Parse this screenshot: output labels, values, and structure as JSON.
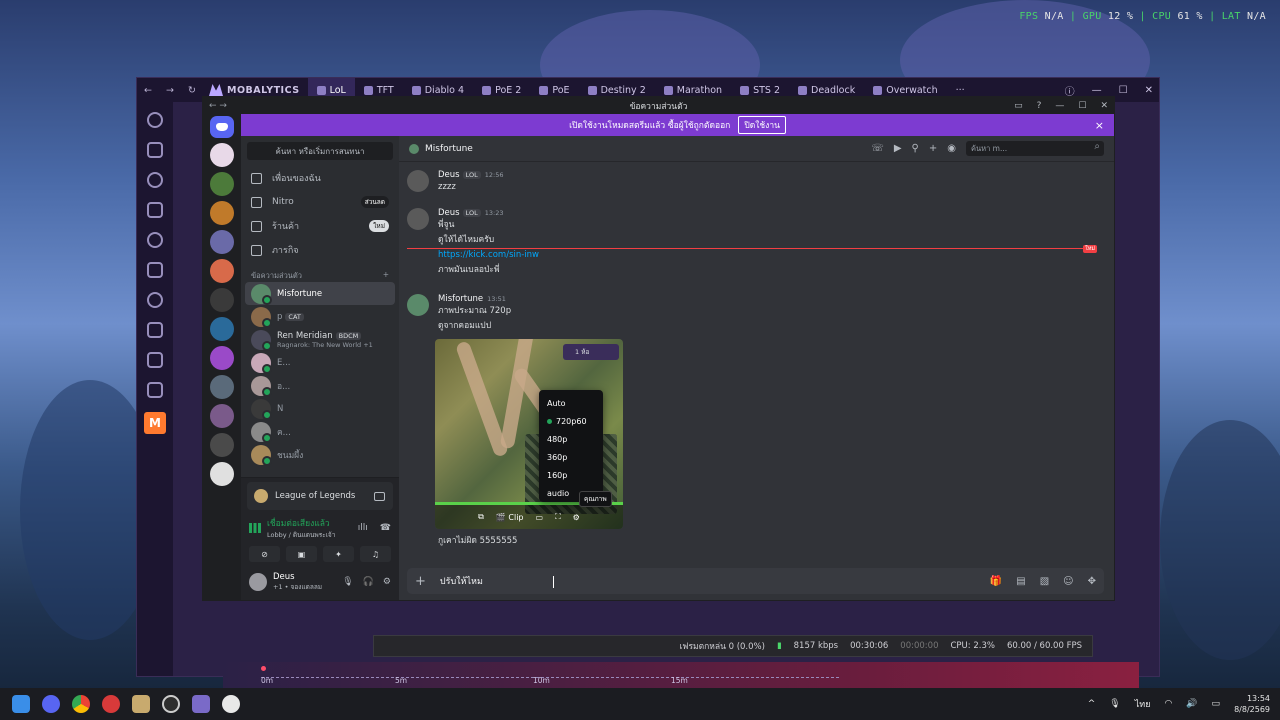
{
  "hud": {
    "fps_label": "FPS",
    "fps_value": "N/A",
    "gpu_label": "GPU",
    "gpu_value": "12 %",
    "cpu_label": "CPU",
    "cpu_value": "61 %",
    "lat_label": "LAT",
    "lat_value": "N/A",
    "sep": "|"
  },
  "mobalytics": {
    "brand": "MOBALYTICS",
    "tabs": [
      {
        "label": "LoL"
      },
      {
        "label": "TFT"
      },
      {
        "label": "Diablo 4"
      },
      {
        "label": "PoE 2"
      },
      {
        "label": "PoE"
      },
      {
        "label": "Destiny 2"
      },
      {
        "label": "Marathon"
      },
      {
        "label": "STS 2"
      },
      {
        "label": "Deadlock"
      },
      {
        "label": "Overwatch"
      }
    ],
    "more": "···",
    "side_badge": "M",
    "tooltip": "Outp"
  },
  "obs": {
    "dropped": "เฟรมตกหล่น 0 (0.0%)",
    "bitrate": "8157 kbps",
    "rec_time": "00:30:06",
    "stream_time": "00:00:00",
    "cpu": "CPU: 2.3%",
    "fps": "60.00 / 60.00 FPS"
  },
  "timeline": {
    "t0": "0m",
    "t1": "5m",
    "t2": "10m",
    "t3": "15m"
  },
  "discord": {
    "window_title": "ข้อความส่วนตัว",
    "banner": {
      "text": "เปิดใช้งานโหมดสตรีมแล้ว ซื้อผู้ใช้ถูกตัดออก",
      "button": "ปิดใช้งาน",
      "close": "×"
    },
    "search_dm": "ค้นหา หรือเริ่มการสนทนา",
    "nav": [
      {
        "label": "เพื่อนของฉัน",
        "tag": ""
      },
      {
        "label": "Nitro",
        "tag": "ส่วนลด"
      },
      {
        "label": "ร้านค้า",
        "tag": "ใหม่"
      },
      {
        "label": "ภารกิจ",
        "tag": ""
      }
    ],
    "dm_header": "ข้อความส่วนตัว",
    "dm_add": "+",
    "dms": [
      {
        "name": "Misfortune",
        "badge": "",
        "sub": ""
      },
      {
        "name": "p",
        "badge": "CAT",
        "sub": ""
      },
      {
        "name": "Ren Meridian",
        "badge": "BDCM",
        "sub": "Ragnarok: The New World +1"
      },
      {
        "name": "E...",
        "badge": "",
        "sub": ""
      },
      {
        "name": "อ...",
        "badge": "",
        "sub": ""
      },
      {
        "name": "N",
        "badge": "",
        "sub": ""
      },
      {
        "name": "ค...",
        "badge": "",
        "sub": ""
      },
      {
        "name": "ชนมผึ้ง",
        "badge": "",
        "sub": ""
      }
    ],
    "activity_game": "League of Legends",
    "voice_status": "เชื่อมต่อเสียงแล้ว",
    "voice_channel": "Lobby / ดินแดนพระเจ้า",
    "user_name": "Deus",
    "user_status": "+1 • จองแดลลม",
    "chat": {
      "channel": "Misfortune",
      "search_placeholder": "ค้นหา m...",
      "messages": [
        {
          "author": "Deus",
          "badge": "LOL",
          "time": "12:56",
          "lines": [
            "zzzz"
          ]
        },
        {
          "author": "Deus",
          "badge": "LOL",
          "time": "13:23",
          "lines": [
            "พี่จูน",
            "ดูให้ได้ไหมครับ",
            "https://kick.com/sin-inw",
            "ภาพมันเบลอป่ะพี่"
          ]
        },
        {
          "author": "Misfortune",
          "badge": "",
          "time": "13:51",
          "lines": [
            "ภาพประมาณ 720p",
            "ดูจากคอมแปป"
          ]
        }
      ],
      "new_label": "ใหม่",
      "video_hud": "1 ห้อ",
      "quality_options": [
        "Auto",
        "720p60",
        "480p",
        "360p",
        "160p",
        "audio"
      ],
      "quality_tooltip": "คุณภาพ",
      "clip_label": "Clip",
      "after_video": "กูเคาไม่ผิด 5555555",
      "composer_text": "ปรับให้ไหม"
    }
  },
  "taskbar": {
    "lang": "ไทย",
    "time": "13:54",
    "date": "8/8/2569"
  }
}
